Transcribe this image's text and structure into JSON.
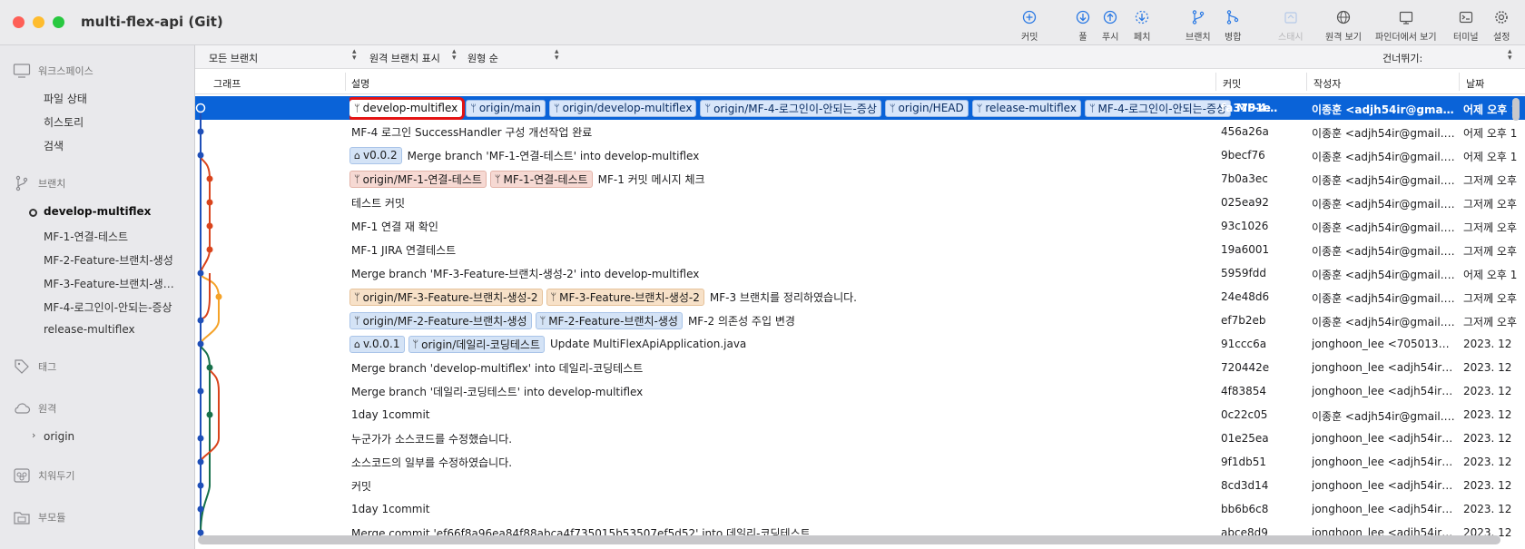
{
  "window": {
    "title": "multi-flex-api (Git)"
  },
  "toolbar": {
    "commit": "커밋",
    "pull": "풀",
    "push": "푸시",
    "fetch": "페치",
    "branch": "브랜치",
    "merge": "병합",
    "stash": "스태시",
    "show_remote": "원격 보기",
    "show_in_finder": "파인더에서 보기",
    "terminal": "터미널",
    "settings": "설정"
  },
  "sidebar": {
    "workspace": {
      "label": "워크스페이스",
      "items": [
        "파일 상태",
        "히스토리",
        "검색"
      ]
    },
    "branches": {
      "label": "브랜치",
      "items": [
        "develop-multiflex",
        "MF-1-연결-테스트",
        "MF-2-Feature-브랜치-생성",
        "MF-3-Feature-브랜치-생…",
        "MF-4-로그인이-안되는-증상",
        "release-multiflex"
      ],
      "current": "develop-multiflex"
    },
    "tags": {
      "label": "태그"
    },
    "remotes": {
      "label": "원격",
      "items": [
        "origin"
      ]
    },
    "stashes": {
      "label": "치워두기"
    },
    "submodules": {
      "label": "부모듈"
    }
  },
  "filters": {
    "branches": "모든 브랜치",
    "remote": "원격 브랜치 표시",
    "order": "원형 순",
    "jump": "건너뛰기:"
  },
  "columns": {
    "graph": "그래프",
    "desc": "설명",
    "commit": "커밋",
    "author": "작성자",
    "date": "날짜"
  },
  "colors": {
    "blue": "#1f4fb8",
    "red": "#d9441c",
    "orange": "#f5a228",
    "green": "#17704a",
    "selection": "#0a63d8",
    "highlight": "#e41414"
  },
  "commits": [
    {
      "refs": [
        {
          "type": "branch",
          "name": "develop-multiflex",
          "style": "hl"
        },
        {
          "type": "branch",
          "name": "origin/main",
          "style": "sel"
        },
        {
          "type": "branch",
          "name": "origin/develop-multiflex",
          "style": "sel"
        },
        {
          "type": "branch",
          "name": "origin/MF-4-로그인이-안되는-증상",
          "style": "sel"
        },
        {
          "type": "branch",
          "name": "origin/HEAD",
          "style": "sel"
        },
        {
          "type": "branch",
          "name": "release-multiflex",
          "style": "sel"
        },
        {
          "type": "branch",
          "name": "MF-4-로그인이-안되는-증상",
          "style": "sel"
        }
      ],
      "message": "MF-4…",
      "hash": "fa3791e",
      "author": "이종훈 <adjh54ir@gmail.…",
      "date": "어제 오후 1",
      "selected": true
    },
    {
      "refs": [],
      "message": "MF-4 로그인 SuccessHandler 구성 개선작업 완료",
      "hash": "456a26a",
      "author": "이종훈 <adjh54ir@gmail.co…",
      "date": "어제 오후 1"
    },
    {
      "refs": [
        {
          "type": "tag",
          "name": "v0.0.2",
          "style": "blue"
        }
      ],
      "message": "Merge branch 'MF-1-연결-테스트' into develop-multiflex",
      "hash": "9becf76",
      "author": "이종훈 <adjh54ir@gmail.co…",
      "date": "어제 오후 1"
    },
    {
      "refs": [
        {
          "type": "branch",
          "name": "origin/MF-1-연결-테스트",
          "style": "red"
        },
        {
          "type": "branch",
          "name": "MF-1-연결-테스트",
          "style": "red"
        }
      ],
      "message": "MF-1 커밋 메시지 체크",
      "hash": "7b0a3ec",
      "author": "이종훈 <adjh54ir@gmail.co…",
      "date": "그저께 오후"
    },
    {
      "refs": [],
      "message": "테스트 커밋",
      "hash": "025ea92",
      "author": "이종훈 <adjh54ir@gmail.co…",
      "date": "그저께 오후"
    },
    {
      "refs": [],
      "message": "MF-1 연결 재 확인",
      "hash": "93c1026",
      "author": "이종훈 <adjh54ir@gmail.co…",
      "date": "그저께 오후"
    },
    {
      "refs": [],
      "message": "MF-1 JIRA 연결테스트",
      "hash": "19a6001",
      "author": "이종훈 <adjh54ir@gmail.co…",
      "date": "그저께 오후"
    },
    {
      "refs": [],
      "message": "Merge branch 'MF-3-Feature-브랜치-생성-2' into develop-multiflex",
      "hash": "5959fdd",
      "author": "이종훈 <adjh54ir@gmail.co…",
      "date": "어제 오후 1"
    },
    {
      "refs": [
        {
          "type": "branch",
          "name": "origin/MF-3-Feature-브랜치-생성-2",
          "style": "orange"
        },
        {
          "type": "branch",
          "name": "MF-3-Feature-브랜치-생성-2",
          "style": "orange"
        }
      ],
      "message": "MF-3 브랜치를 정리하였습니다.",
      "hash": "24e48d6",
      "author": "이종훈 <adjh54ir@gmail.co…",
      "date": "그저께 오후"
    },
    {
      "refs": [
        {
          "type": "branch",
          "name": "origin/MF-2-Feature-브랜치-생성",
          "style": "blue"
        },
        {
          "type": "branch",
          "name": "MF-2-Feature-브랜치-생성",
          "style": "blue"
        }
      ],
      "message": "MF-2 의존성 주입 변경",
      "hash": "ef7b2eb",
      "author": "이종훈 <adjh54ir@gmail.co…",
      "date": "그저께 오후"
    },
    {
      "refs": [
        {
          "type": "tag",
          "name": "v.0.0.1",
          "style": "blue"
        },
        {
          "type": "branch",
          "name": "origin/데일리-코딩테스트",
          "style": "blue"
        }
      ],
      "message": "Update MultiFlexApiApplication.java",
      "hash": "91ccc6a",
      "author": "jonghoon_lee <70501374…",
      "date": "2023. 12"
    },
    {
      "refs": [],
      "message": "Merge branch 'develop-multiflex' into 데일리-코딩테스트",
      "hash": "720442e",
      "author": "jonghoon_lee <adjh54ir@…",
      "date": "2023. 12"
    },
    {
      "refs": [],
      "message": "Merge branch '데일리-코딩테스트' into develop-multiflex",
      "hash": "4f83854",
      "author": "jonghoon_lee <adjh54ir@…",
      "date": "2023. 12"
    },
    {
      "refs": [],
      "message": "1day 1commit",
      "hash": "0c22c05",
      "author": "이종훈 <adjh54ir@gmail.co…",
      "date": "2023. 12"
    },
    {
      "refs": [],
      "message": "누군가가 소스코드를 수정했습니다.",
      "hash": "01e25ea",
      "author": "jonghoon_lee <adjh54ir@…",
      "date": "2023. 12"
    },
    {
      "refs": [],
      "message": "소스코드의 일부를 수정하였습니다.",
      "hash": "9f1db51",
      "author": "jonghoon_lee <adjh54ir@…",
      "date": "2023. 12"
    },
    {
      "refs": [],
      "message": "커밋",
      "hash": "8cd3d14",
      "author": "jonghoon_lee <adjh54ir@…",
      "date": "2023. 12"
    },
    {
      "refs": [],
      "message": "1day 1commit",
      "hash": "bb6b6c8",
      "author": "jonghoon_lee <adjh54ir@…",
      "date": "2023. 12"
    },
    {
      "refs": [],
      "message": "Merge commit 'ef66f8a96ea84f88abca4f735015b53507ef5d52' into 데일리-코딩테스트",
      "hash": "abce8d9",
      "author": "jonghoon_lee <adjh54ir@…",
      "date": "2023. 12"
    }
  ]
}
